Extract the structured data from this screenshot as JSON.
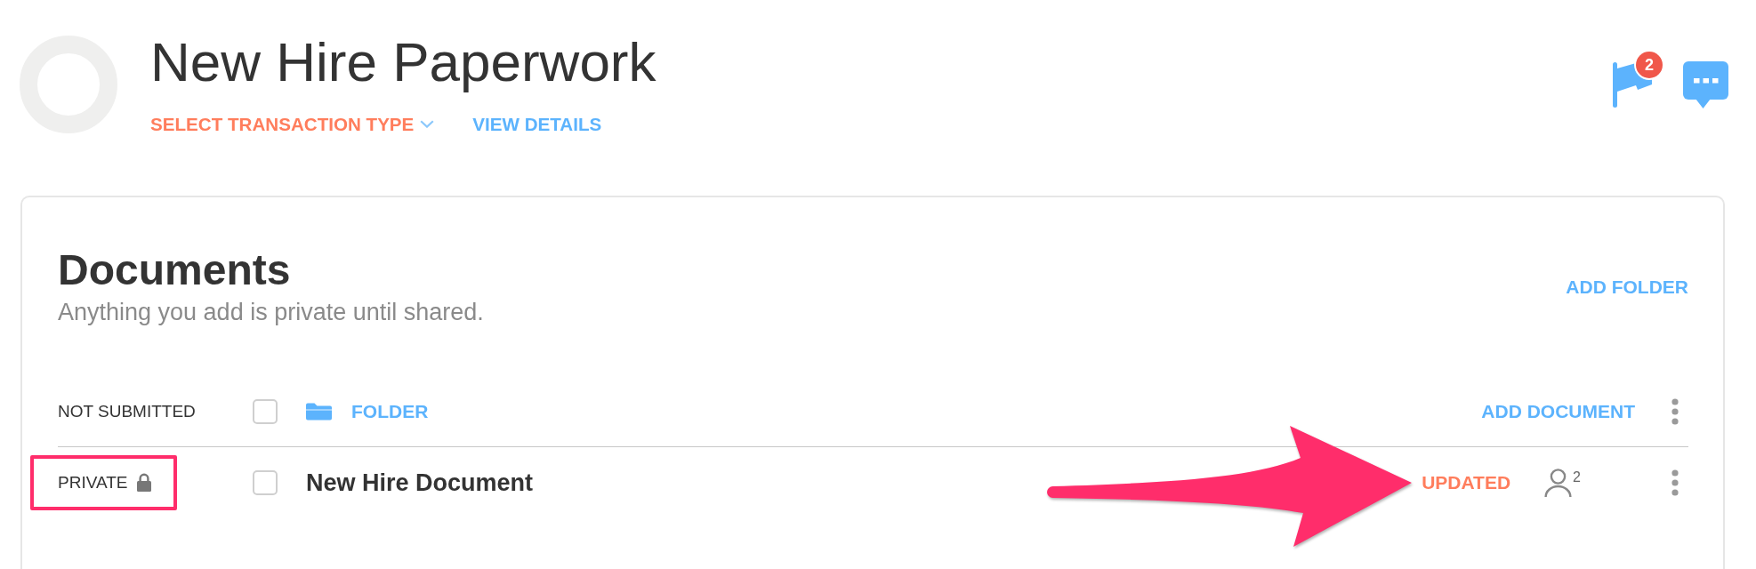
{
  "header": {
    "title": "New Hire Paperwork",
    "links": [
      {
        "kind": "dropdown",
        "label": "SELECT TRANSACTION TYPE"
      },
      {
        "kind": "link",
        "label": "VIEW DETAILS"
      }
    ],
    "flag_badge": "2"
  },
  "documents": {
    "title": "Documents",
    "subtitle": "Anything you add is private until shared.",
    "add_folder": "ADD FOLDER",
    "rows": [
      {
        "kind": "folder",
        "status": {
          "label": "NOT SUBMITTED",
          "locked": false,
          "highlighted": false
        },
        "checked": false,
        "name": "FOLDER",
        "action": "ADD DOCUMENT"
      },
      {
        "kind": "document",
        "status": {
          "label": "PRIVATE",
          "locked": true,
          "highlighted": true
        },
        "checked": false,
        "name": "New Hire Document",
        "update_status": "UPDATED",
        "shared_count": "2"
      }
    ]
  },
  "annotations": [
    {
      "kind": "arrow"
    }
  ]
}
